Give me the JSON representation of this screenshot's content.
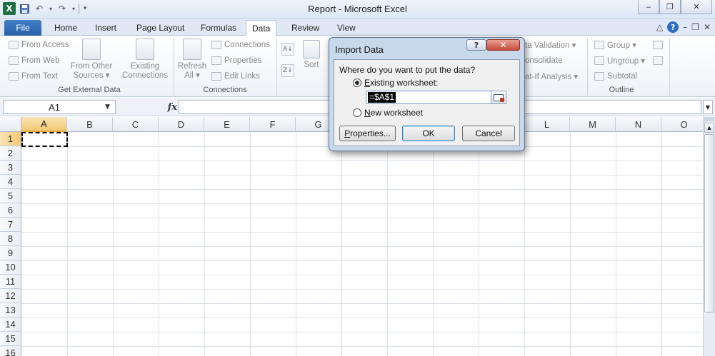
{
  "window": {
    "title": "Report  -  Microsoft Excel",
    "logo": "X",
    "min": "‒",
    "restore": "❐",
    "close": "✕"
  },
  "qat": {
    "save_icon": "save-icon",
    "undo": "↶",
    "redo": "↷",
    "customize": "▾"
  },
  "tabs": {
    "file": "File",
    "items": [
      "Home",
      "Insert",
      "Page Layout",
      "Formulas",
      "Data",
      "Review",
      "View"
    ],
    "active": "Data",
    "help": "?",
    "right_icons": [
      "△",
      "–",
      "❐",
      "✕"
    ]
  },
  "ribbon": {
    "get_external_data": {
      "label": "Get External Data",
      "from_access": "From Access",
      "from_web": "From Web",
      "from_text": "From Text",
      "from_other_sources": "From Other",
      "from_other_sources_2": "Sources ▾",
      "existing_connections": "Existing",
      "existing_connections_2": "Connections"
    },
    "connections": {
      "label": "Connections",
      "refresh_all": "Refresh",
      "refresh_all_2": "All ▾",
      "connections": "Connections",
      "properties": "Properties",
      "edit_links": "Edit Links"
    },
    "sort_filter": {
      "sort": "Sort"
    },
    "data_tools": {
      "data_validation": "ta Validation ▾",
      "consolidate": "onsolidate",
      "what_if": "at-If Analysis ▾"
    },
    "outline": {
      "label": "Outline",
      "group": "Group ▾",
      "ungroup": "Ungroup ▾",
      "subtotal": "Subtotal"
    }
  },
  "formula_bar": {
    "name_box": "A1",
    "fx": "fx",
    "value": ""
  },
  "grid": {
    "columns": [
      "A",
      "B",
      "C",
      "D",
      "E",
      "F",
      "G",
      "H",
      "I",
      "J",
      "K",
      "L",
      "M",
      "N",
      "O"
    ],
    "rows": [
      "1",
      "2",
      "3",
      "4",
      "5",
      "6",
      "7",
      "8",
      "9",
      "10",
      "11",
      "12",
      "13",
      "14",
      "15",
      "16"
    ],
    "active_cell": "A1"
  },
  "dialog": {
    "title": "Import Data",
    "help": "?",
    "close": "✕",
    "question": "Where do you want to put the data?",
    "existing_prefix": "E",
    "existing_rest": "xisting worksheet:",
    "reference": "=$A$1",
    "new_prefix": "N",
    "new_rest": "ew worksheet",
    "properties_prefix": "P",
    "properties_rest": "roperties...",
    "ok": "OK",
    "cancel": "Cancel",
    "selected_option": "existing"
  }
}
